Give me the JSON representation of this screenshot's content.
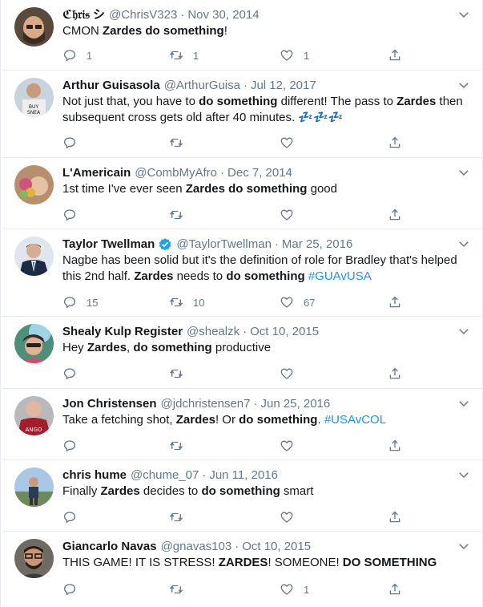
{
  "tweets": [
    {
      "name": "ℭ𝔥𝔯𝔦𝔰 シ",
      "handle": "@ChrisV323",
      "date": "Nov 30, 2014",
      "verified": false,
      "text": [
        {
          "t": "CMON ",
          "s": "n"
        },
        {
          "t": "Zardes do something",
          "s": "b"
        },
        {
          "t": "!",
          "s": "n"
        }
      ],
      "replies": "1",
      "retweets": "1",
      "likes": "1"
    },
    {
      "name": "Arthur Guisasola",
      "handle": "@ArthurGuisa",
      "date": "Jul 12, 2017",
      "verified": false,
      "text": [
        {
          "t": "Not just that, you have to ",
          "s": "n"
        },
        {
          "t": "do something",
          "s": "b"
        },
        {
          "t": " different! The pass to ",
          "s": "n"
        },
        {
          "t": "Zardes",
          "s": "b"
        },
        {
          "t": " then subsequent cross gets old after 40 minutes. ",
          "s": "n"
        },
        {
          "t": "💤💤💤",
          "s": "z"
        }
      ],
      "replies": "",
      "retweets": "",
      "likes": ""
    },
    {
      "name": "L'Americain",
      "handle": "@CombMyAfro",
      "date": "Dec 7, 2014",
      "verified": false,
      "text": [
        {
          "t": "1st time I've ever seen ",
          "s": "n"
        },
        {
          "t": "Zardes do something",
          "s": "b"
        },
        {
          "t": " good",
          "s": "n"
        }
      ],
      "replies": "",
      "retweets": "",
      "likes": ""
    },
    {
      "name": "Taylor Twellman",
      "handle": "@TaylorTwellman",
      "date": "Mar 25, 2016",
      "verified": true,
      "text": [
        {
          "t": "Nagbe has been solid but it's the definition of role for Bradley that's helped this 2nd half. ",
          "s": "n"
        },
        {
          "t": "Zardes",
          "s": "b"
        },
        {
          "t": " needs to ",
          "s": "n"
        },
        {
          "t": "do something",
          "s": "b"
        },
        {
          "t": " ",
          "s": "n"
        },
        {
          "t": "#GUAvUSA",
          "s": "h"
        }
      ],
      "replies": "15",
      "retweets": "10",
      "likes": "67"
    },
    {
      "name": "Shealy Kulp Register",
      "handle": "@shealzk",
      "date": "Oct 10, 2015",
      "verified": false,
      "text": [
        {
          "t": "Hey ",
          "s": "n"
        },
        {
          "t": "Zardes",
          "s": "b"
        },
        {
          "t": ", ",
          "s": "n"
        },
        {
          "t": "do something",
          "s": "b"
        },
        {
          "t": " productive",
          "s": "n"
        }
      ],
      "replies": "",
      "retweets": "",
      "likes": ""
    },
    {
      "name": "Jon Christensen",
      "handle": "@jdchristensen7",
      "date": "Jun 25, 2016",
      "verified": false,
      "text": [
        {
          "t": "Take a fetching shot, ",
          "s": "n"
        },
        {
          "t": "Zardes",
          "s": "b"
        },
        {
          "t": "! Or ",
          "s": "n"
        },
        {
          "t": "do something",
          "s": "b"
        },
        {
          "t": ". ",
          "s": "n"
        },
        {
          "t": "#USAvCOL",
          "s": "h"
        }
      ],
      "replies": "",
      "retweets": "",
      "likes": ""
    },
    {
      "name": "chris hume",
      "handle": "@chume_07",
      "date": "Jun 11, 2016",
      "verified": false,
      "text": [
        {
          "t": "Finally ",
          "s": "n"
        },
        {
          "t": "Zardes",
          "s": "b"
        },
        {
          "t": " decides to ",
          "s": "n"
        },
        {
          "t": "do something",
          "s": "b"
        },
        {
          "t": " smart",
          "s": "n"
        }
      ],
      "replies": "",
      "retweets": "",
      "likes": ""
    },
    {
      "name": "Giancarlo Navas",
      "handle": "@gnavas103",
      "date": "Oct 10, 2015",
      "verified": false,
      "text": [
        {
          "t": "THIS GAME! IT IS STRESS! ",
          "s": "n"
        },
        {
          "t": "ZARDES",
          "s": "b"
        },
        {
          "t": "! SOMEONE! ",
          "s": "n"
        },
        {
          "t": "DO SOMETHING",
          "s": "b"
        }
      ],
      "replies": "",
      "retweets": "",
      "likes": "1"
    }
  ],
  "colors": {
    "text": "#14171a",
    "muted": "#657786",
    "link": "#1b95e0",
    "verified": "#1da1f2",
    "divider": "#e6ecf0"
  },
  "icons": {
    "reply": "speech-bubble-icon",
    "retweet": "retweet-arrows-icon",
    "like": "heart-icon",
    "share": "share-upload-icon",
    "menu": "chevron-down-icon",
    "verified": "verified-badge-icon"
  }
}
